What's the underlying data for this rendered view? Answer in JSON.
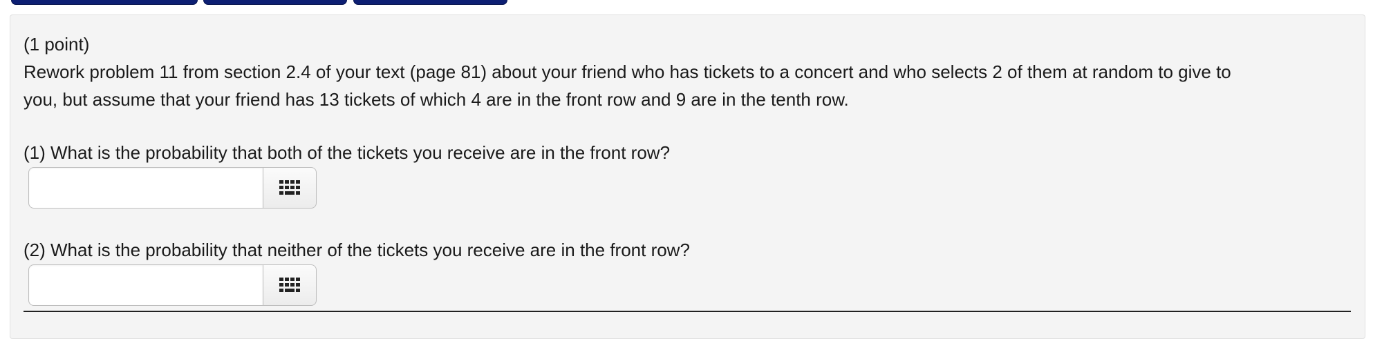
{
  "problem": {
    "points": "(1 point)",
    "statement_line1": "Rework problem 11 from section 2.4 of your text (page 81) about your friend who has tickets to a concert and who selects 2 of them at random to give to",
    "statement_line2": "you, but assume that your friend has 13 tickets of which 4 are in the front row and 9 are in the tenth row."
  },
  "questions": [
    {
      "prompt": "(1) What is the probability that both of the tickets you receive are in the front row?",
      "answer_value": "",
      "keypad_icon": "keypad-icon"
    },
    {
      "prompt": "(2) What is the probability that neither of the tickets you receive are in the front row?",
      "answer_value": "",
      "keypad_icon": "keypad-icon"
    }
  ],
  "colors": {
    "tab_navy": "#0d1f73",
    "panel_background": "#f4f4f4"
  }
}
